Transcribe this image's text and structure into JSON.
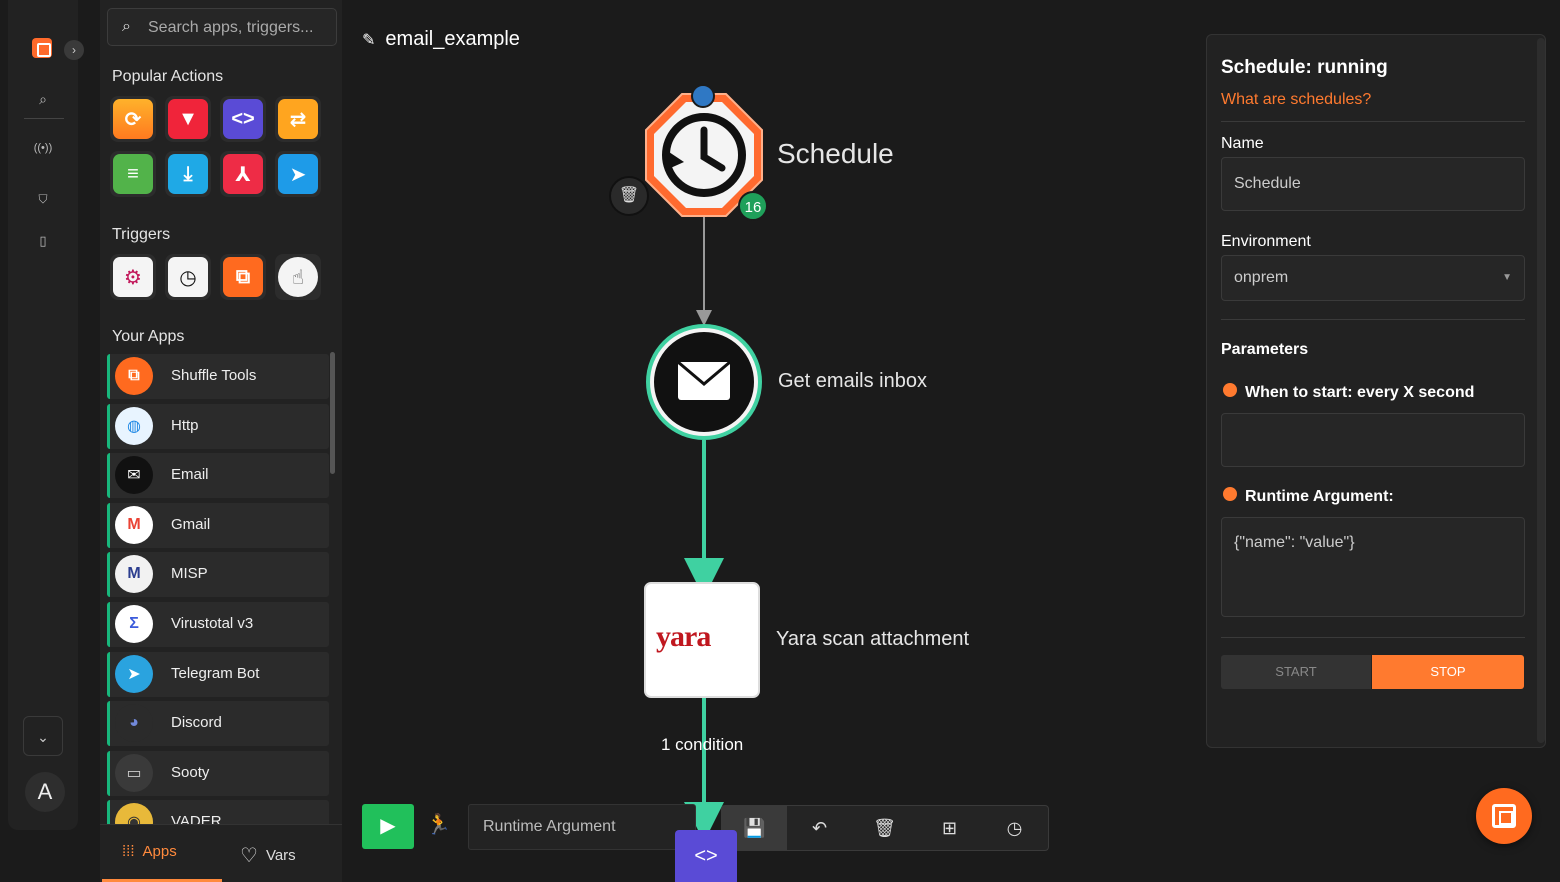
{
  "sidebar": {
    "search_placeholder": "Search apps, triggers...",
    "popular_actions_title": "Popular Actions",
    "triggers_title": "Triggers",
    "your_apps_title": "Your Apps",
    "apps": [
      {
        "label": "Shuffle Tools",
        "icon": "shuffle-tools-icon"
      },
      {
        "label": "Http",
        "icon": "globe-icon"
      },
      {
        "label": "Email",
        "icon": "envelope-icon"
      },
      {
        "label": "Gmail",
        "icon": "gmail-icon"
      },
      {
        "label": "MISP",
        "icon": "misp-icon"
      },
      {
        "label": "Virustotal v3",
        "icon": "sigma-icon"
      },
      {
        "label": "Telegram Bot",
        "icon": "telegram-icon"
      },
      {
        "label": "Discord",
        "icon": "discord-icon"
      },
      {
        "label": "Sooty",
        "icon": "sooty-icon"
      },
      {
        "label": "VADER",
        "icon": "vader-icon"
      }
    ],
    "tabs": {
      "apps": "Apps",
      "vars": "Vars"
    }
  },
  "canvas": {
    "workflow_name": "email_example",
    "nodes": [
      {
        "label": "Schedule",
        "type": "trigger"
      },
      {
        "label": "Get emails inbox",
        "type": "action"
      },
      {
        "label": "Yara scan attachment",
        "type": "action",
        "logo_text": "yara"
      }
    ],
    "schedule_badge": "16",
    "condition_label": "1 condition",
    "runtime_placeholder": "Runtime Argument"
  },
  "panel": {
    "title": "Schedule: running",
    "help_link": "What are schedules?",
    "name_label": "Name",
    "name_value": "Schedule",
    "environment_label": "Environment",
    "environment_value": "onprem",
    "parameters_label": "Parameters",
    "when_label": "When to start: every X second",
    "when_value": "",
    "runtime_label": "Runtime Argument:",
    "runtime_value": "{\"name\": \"value\"}",
    "start_label": "START",
    "stop_label": "STOP"
  },
  "rail": {
    "avatar_letter": "A"
  },
  "colors": {
    "accent": "#ff7a2f",
    "edge": "#3fd1a1",
    "play": "#21c05b"
  }
}
